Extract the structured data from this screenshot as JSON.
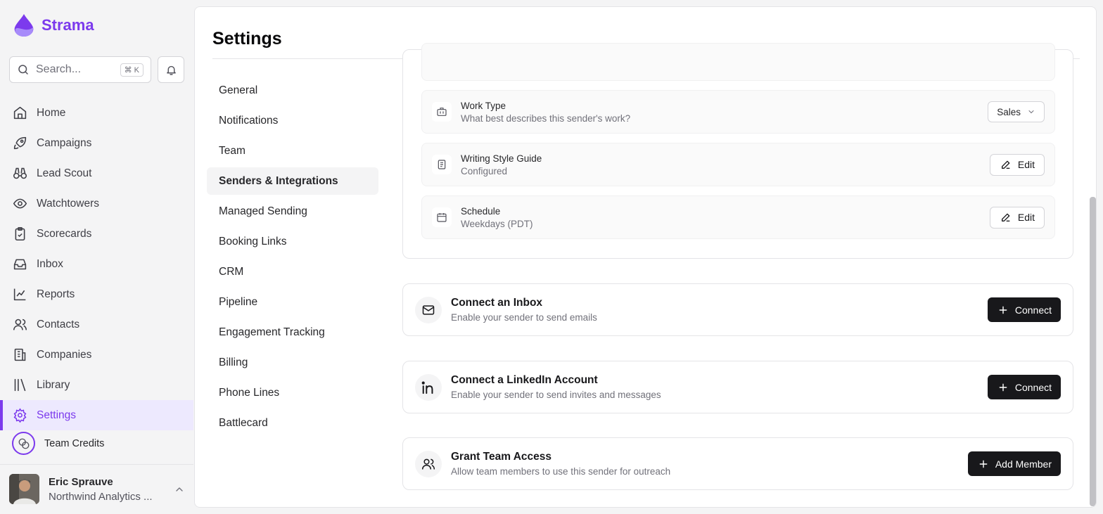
{
  "brand": {
    "name": "Strama",
    "accent": "#7c3aed"
  },
  "search": {
    "placeholder": "Search...",
    "shortcut": "⌘ K"
  },
  "sidebar": {
    "items": [
      {
        "label": "Home",
        "icon": "home-icon"
      },
      {
        "label": "Campaigns",
        "icon": "rocket-icon"
      },
      {
        "label": "Lead Scout",
        "icon": "binoculars-icon"
      },
      {
        "label": "Watchtowers",
        "icon": "eye-icon"
      },
      {
        "label": "Scorecards",
        "icon": "clipboard-check-icon"
      },
      {
        "label": "Inbox",
        "icon": "inbox-icon"
      },
      {
        "label": "Reports",
        "icon": "line-chart-icon"
      },
      {
        "label": "Contacts",
        "icon": "users-icon"
      },
      {
        "label": "Companies",
        "icon": "building-icon"
      },
      {
        "label": "Library",
        "icon": "library-icon"
      },
      {
        "label": "Settings",
        "icon": "gear-icon",
        "active": true
      }
    ],
    "credits_label": "Team Credits"
  },
  "user": {
    "name": "Eric Sprauve",
    "org": "Northwind Analytics ..."
  },
  "page": {
    "title": "Settings"
  },
  "settings_nav": [
    {
      "label": "General"
    },
    {
      "label": "Notifications"
    },
    {
      "label": "Team"
    },
    {
      "label": "Senders & Integrations",
      "active": true
    },
    {
      "label": "Managed Sending"
    },
    {
      "label": "Booking Links"
    },
    {
      "label": "CRM"
    },
    {
      "label": "Pipeline"
    },
    {
      "label": "Engagement Tracking"
    },
    {
      "label": "Billing"
    },
    {
      "label": "Phone Lines"
    },
    {
      "label": "Battlecard"
    }
  ],
  "sender_settings": {
    "work_type": {
      "title": "Work Type",
      "subtitle": "What best describes this sender's work?",
      "value": "Sales"
    },
    "style_guide": {
      "title": "Writing Style Guide",
      "subtitle": "Configured",
      "button": "Edit"
    },
    "schedule": {
      "title": "Schedule",
      "subtitle": "Weekdays (PDT)",
      "button": "Edit"
    }
  },
  "actions": {
    "inbox": {
      "title": "Connect an Inbox",
      "subtitle": "Enable your sender to send emails",
      "button": "Connect"
    },
    "linkedin": {
      "title": "Connect a LinkedIn Account",
      "subtitle": "Enable your sender to send invites and messages",
      "button": "Connect"
    },
    "team": {
      "title": "Grant Team Access",
      "subtitle": "Allow team members to use this sender for outreach",
      "button": "Add Member"
    }
  }
}
